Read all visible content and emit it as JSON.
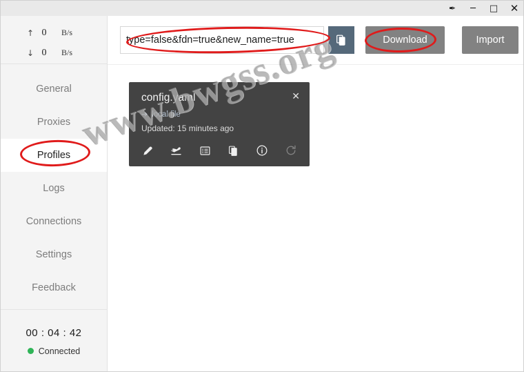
{
  "window": {
    "controls": [
      {
        "name": "pin-icon",
        "glyph": "✒"
      },
      {
        "name": "minimize-button",
        "glyph": "─"
      },
      {
        "name": "maximize-button",
        "glyph": "□"
      },
      {
        "name": "close-button",
        "glyph": "✕"
      }
    ]
  },
  "sidebar": {
    "traffic": {
      "upload": {
        "arrow": "↑",
        "value": "0",
        "unit": "B/s"
      },
      "download": {
        "arrow": "↓",
        "value": "0",
        "unit": "B/s"
      }
    },
    "items": [
      {
        "label": "General",
        "active": false
      },
      {
        "label": "Proxies",
        "active": false
      },
      {
        "label": "Profiles",
        "active": true
      },
      {
        "label": "Logs",
        "active": false
      },
      {
        "label": "Connections",
        "active": false
      },
      {
        "label": "Settings",
        "active": false
      },
      {
        "label": "Feedback",
        "active": false
      }
    ],
    "status": {
      "timer": "00 : 04 : 42",
      "connection_label": "Connected",
      "connection_color": "#2fb457"
    }
  },
  "toolbar": {
    "url_value": "type=false&fdn=true&new_name=true",
    "url_placeholder": "",
    "paste_icon": "copy-icon",
    "download_label": "Download",
    "import_label": "Import"
  },
  "profile_card": {
    "title": "config.yaml",
    "source_arrow": "➔",
    "source_label": "local file",
    "updated_label": "Updated: 15 minutes ago",
    "close_glyph": "✕",
    "actions": [
      {
        "name": "edit-icon",
        "label": "Edit"
      },
      {
        "name": "apply-icon",
        "label": "Apply"
      },
      {
        "name": "rules-icon",
        "label": "Rules"
      },
      {
        "name": "duplicate-icon",
        "label": "Duplicate"
      },
      {
        "name": "info-icon",
        "label": "Info"
      },
      {
        "name": "refresh-icon",
        "label": "Refresh"
      }
    ]
  },
  "annotations": {
    "color": "#e01b1b",
    "targets": [
      "url-input",
      "download-button",
      "sidebar-item-profiles"
    ]
  },
  "watermark": {
    "line1": "www.bwgss.org"
  }
}
